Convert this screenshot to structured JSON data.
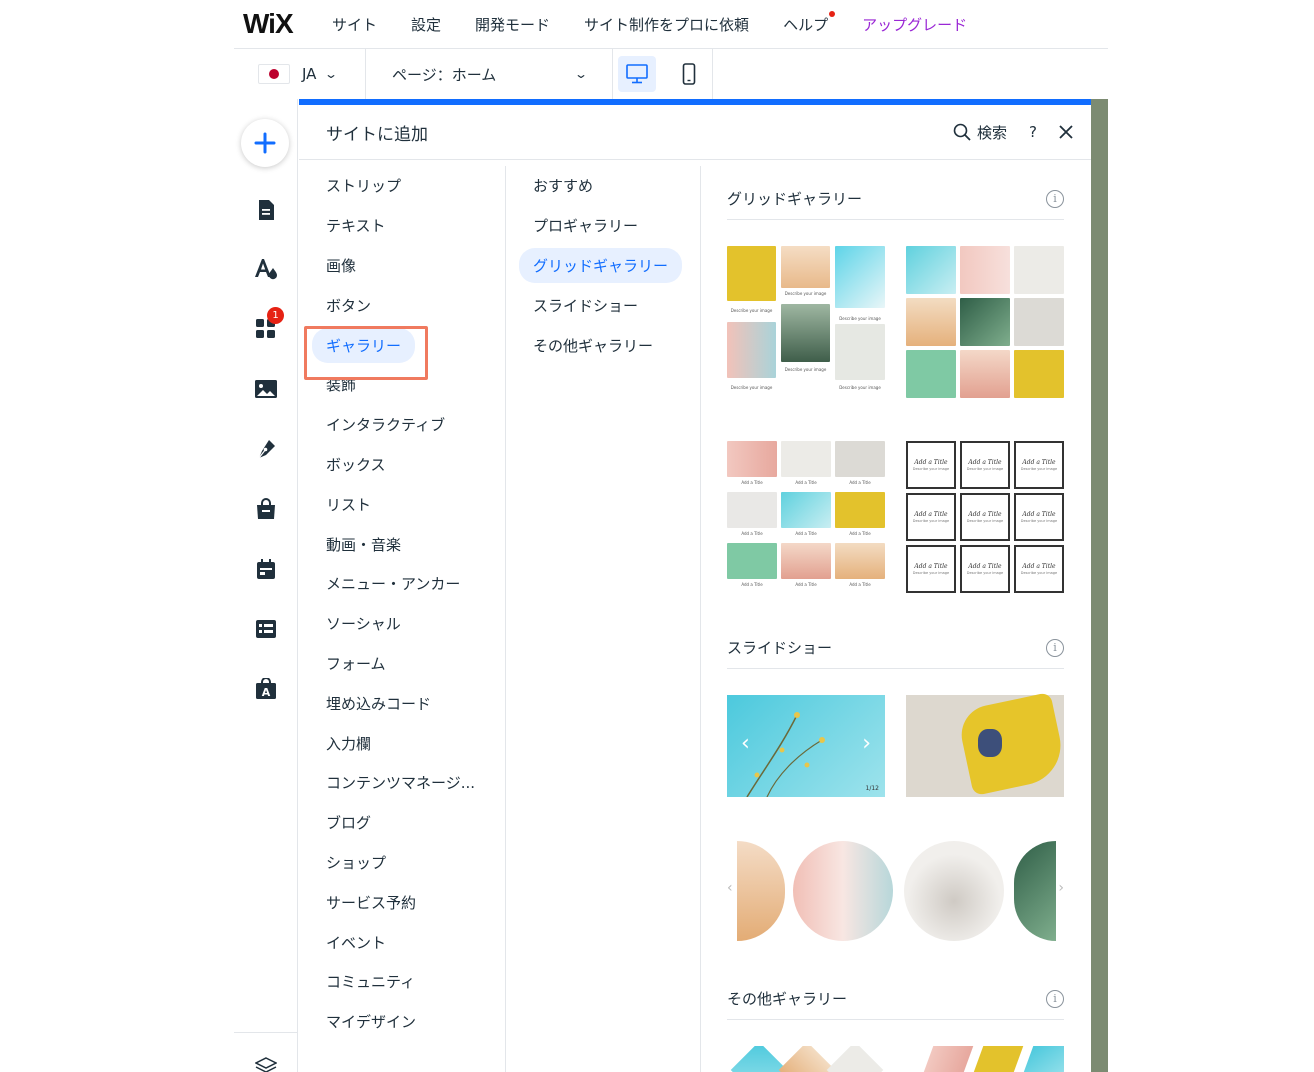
{
  "topbar": {
    "logo": "WiX",
    "menu": [
      {
        "label": "サイト"
      },
      {
        "label": "設定"
      },
      {
        "label": "開発モード"
      },
      {
        "label": "サイト制作をプロに依頼"
      },
      {
        "label": "ヘルプ",
        "has_notification": true
      },
      {
        "label": "アップグレード",
        "accent": "#9a27d5"
      }
    ]
  },
  "secondbar": {
    "language": "JA",
    "page_selector": "ページ：ホーム",
    "devices": [
      {
        "name": "desktop",
        "active": true
      },
      {
        "name": "mobile",
        "active": false
      }
    ]
  },
  "rail": {
    "apps_badge": "1"
  },
  "panel": {
    "title": "サイトに追加",
    "search_label": "検索",
    "help_label": "?",
    "categories": [
      "ストリップ",
      "テキスト",
      "画像",
      "ボタン",
      "ギャラリー",
      "装飾",
      "インタラクティブ",
      "ボックス",
      "リスト",
      "動画・音楽",
      "メニュー・アンカー",
      "ソーシャル",
      "フォーム",
      "埋め込みコード",
      "入力欄",
      "コンテンツマネージ...",
      "ブログ",
      "ショップ",
      "サービス予約",
      "イベント",
      "コミュニティ",
      "マイデザイン"
    ],
    "selected_category": "ギャラリー",
    "subcategories": [
      "おすすめ",
      "プロギャラリー",
      "グリッドギャラリー",
      "スライドショー",
      "その他ギャラリー"
    ],
    "selected_subcategory": "グリッドギャラリー",
    "sections": {
      "grid": "グリッドギャラリー",
      "slideshow": "スライドショー",
      "other": "その他ギャラリー"
    },
    "thumb_text": {
      "describe": "Describe your image",
      "add_title": "Add a Title",
      "frame_desc": "Describe your image",
      "slide_counter": "1/12"
    }
  },
  "colors": {
    "accent": "#116dff",
    "upgrade": "#9a27d5",
    "badge": "#e62214",
    "highlight": "#f07a5f"
  }
}
